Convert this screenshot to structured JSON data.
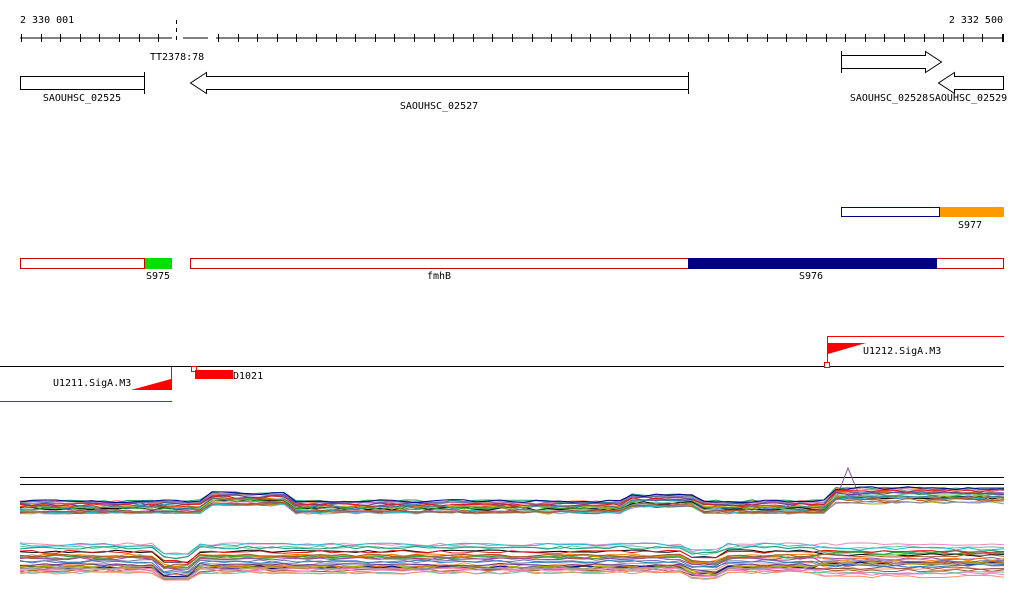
{
  "ruler": {
    "start_label": "2 330 001",
    "end_label": "2 332 500",
    "gap_label": "TT2378:78"
  },
  "genes": [
    {
      "id": "SAOUHSC_02525",
      "strand": "-"
    },
    {
      "id": "SAOUHSC_02527",
      "strand": "-"
    },
    {
      "id": "SAOUHSC_02528",
      "strand": "+"
    },
    {
      "id": "SAOUHSC_02529",
      "strand": "-"
    }
  ],
  "features": [
    {
      "label": "S977",
      "color": "#ff9900"
    },
    {
      "label": "S975",
      "color": "#00e000"
    },
    {
      "label": "fmhB",
      "color": "#ffffff"
    },
    {
      "label": "S976",
      "color": "#000080"
    }
  ],
  "promoters": [
    {
      "label": "U1211.SigA.M3",
      "color": "#ff0000"
    },
    {
      "label": "U1212.SigA.M3",
      "color": "#ff0000"
    },
    {
      "label": "D1021",
      "color": "#ff0000"
    }
  ],
  "colors": {
    "feature_outline": "#cc0000",
    "accent_red": "#ff0000"
  }
}
